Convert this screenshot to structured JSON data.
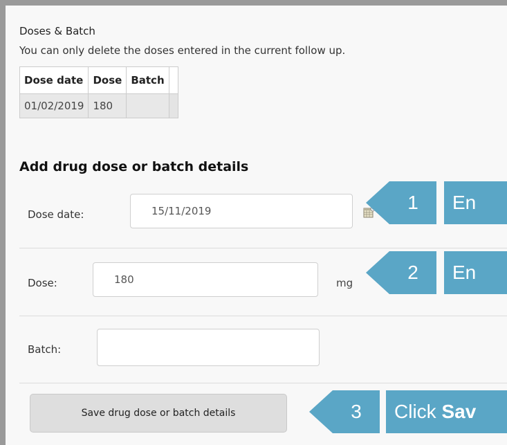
{
  "section": {
    "title": "Doses & Batch",
    "help": "You can only delete the doses entered in the current follow up."
  },
  "table": {
    "headers": [
      "Dose date",
      "Dose",
      "Batch"
    ],
    "rows": [
      [
        "01/02/2019",
        "180",
        ""
      ]
    ]
  },
  "form": {
    "heading": "Add drug dose or batch details",
    "dose_date_label": "Dose date:",
    "dose_date_value": "15/11/2019",
    "dose_label": "Dose:",
    "dose_value": "180",
    "dose_unit": "mg",
    "batch_label": "Batch:",
    "batch_value": "",
    "save_label": "Save drug dose or batch details"
  },
  "callouts": [
    {
      "number": "1",
      "text": "En"
    },
    {
      "number": "2",
      "text": "En"
    },
    {
      "number": "3",
      "text_prefix": "Click ",
      "text_bold": "Sav"
    }
  ],
  "icons": {
    "calendar": "calendar-icon"
  },
  "colors": {
    "callout": "#5aa6c6",
    "button": "#dedede",
    "background": "#f8f8f8"
  }
}
